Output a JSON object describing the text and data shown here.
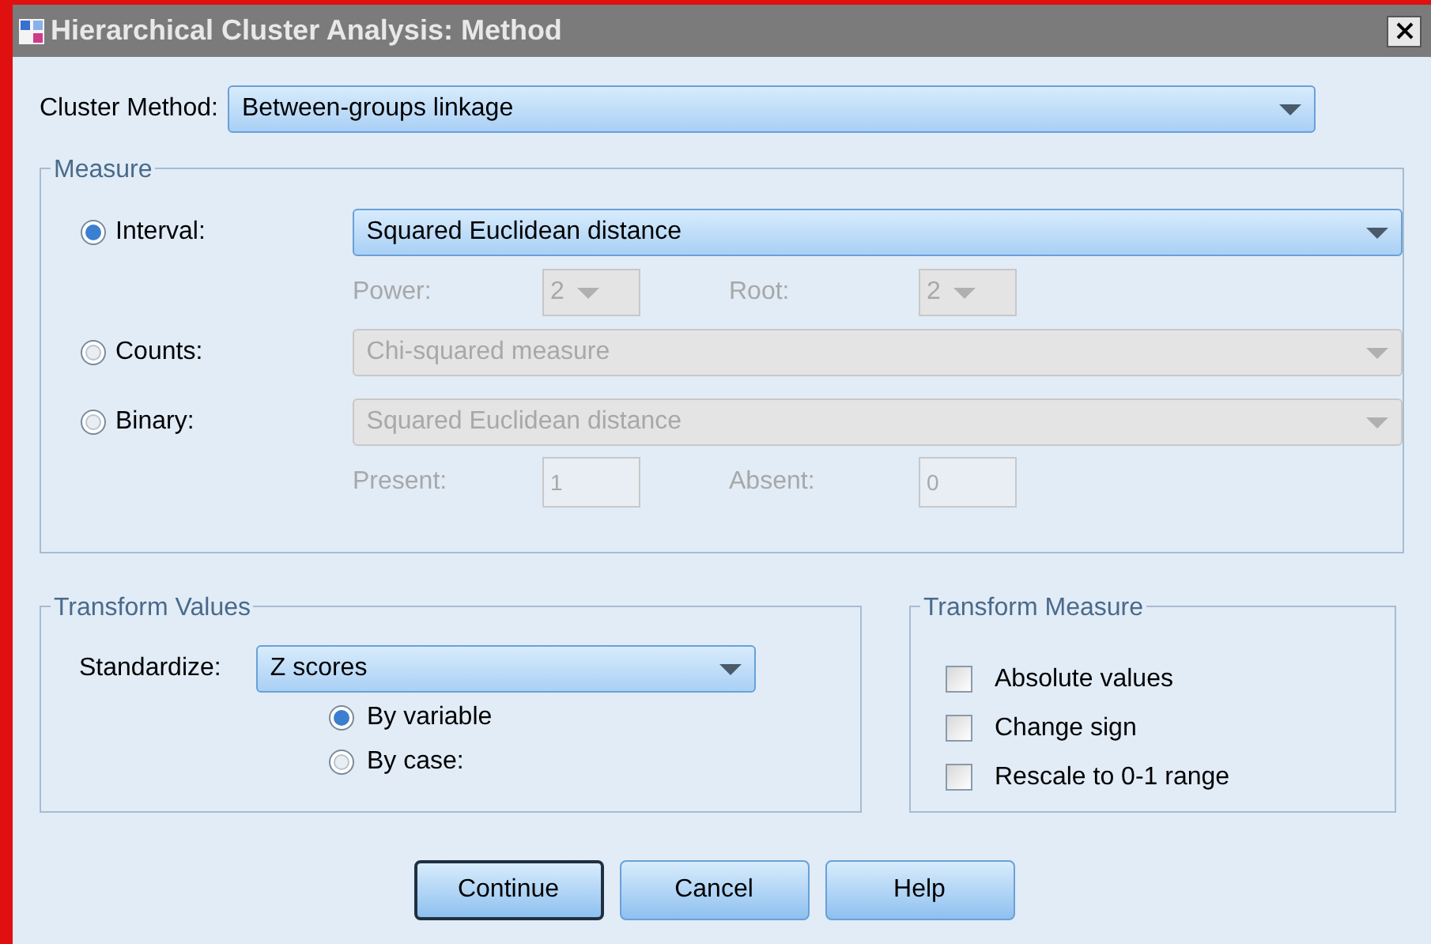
{
  "window": {
    "title": "Hierarchical Cluster Analysis: Method"
  },
  "cluster_method": {
    "label": "Cluster Method:",
    "value": "Between-groups linkage"
  },
  "measure": {
    "title": "Measure",
    "options": [
      {
        "label": "Interval:",
        "selected": true,
        "value": "Squared Euclidean distance",
        "disabled": false
      },
      {
        "label": "Counts:",
        "selected": false,
        "value": "Chi-squared measure",
        "disabled": true
      },
      {
        "label": "Binary:",
        "selected": false,
        "value": "Squared Euclidean distance",
        "disabled": true
      }
    ],
    "interval_params": {
      "disabled": true,
      "items": [
        {
          "label": "Power:",
          "value": "2"
        },
        {
          "label": "Root:",
          "value": "2"
        }
      ]
    },
    "binary_params": {
      "disabled": true,
      "items": [
        {
          "label": "Present:",
          "value": "1"
        },
        {
          "label": "Absent:",
          "value": "0"
        }
      ]
    }
  },
  "transform_values": {
    "title": "Transform Values",
    "standardize": {
      "label": "Standardize:",
      "value": "Z scores"
    },
    "by": [
      {
        "label": "By variable",
        "selected": true
      },
      {
        "label": "By case:",
        "selected": false
      }
    ]
  },
  "transform_measure": {
    "title": "Transform Measure",
    "options": [
      {
        "label": "Absolute values",
        "checked": false
      },
      {
        "label": "Change sign",
        "checked": false
      },
      {
        "label": "Rescale to 0-1 range",
        "checked": false
      }
    ]
  },
  "buttons": [
    {
      "label": "Continue",
      "default": true
    },
    {
      "label": "Cancel",
      "default": false
    },
    {
      "label": "Help",
      "default": false
    }
  ]
}
